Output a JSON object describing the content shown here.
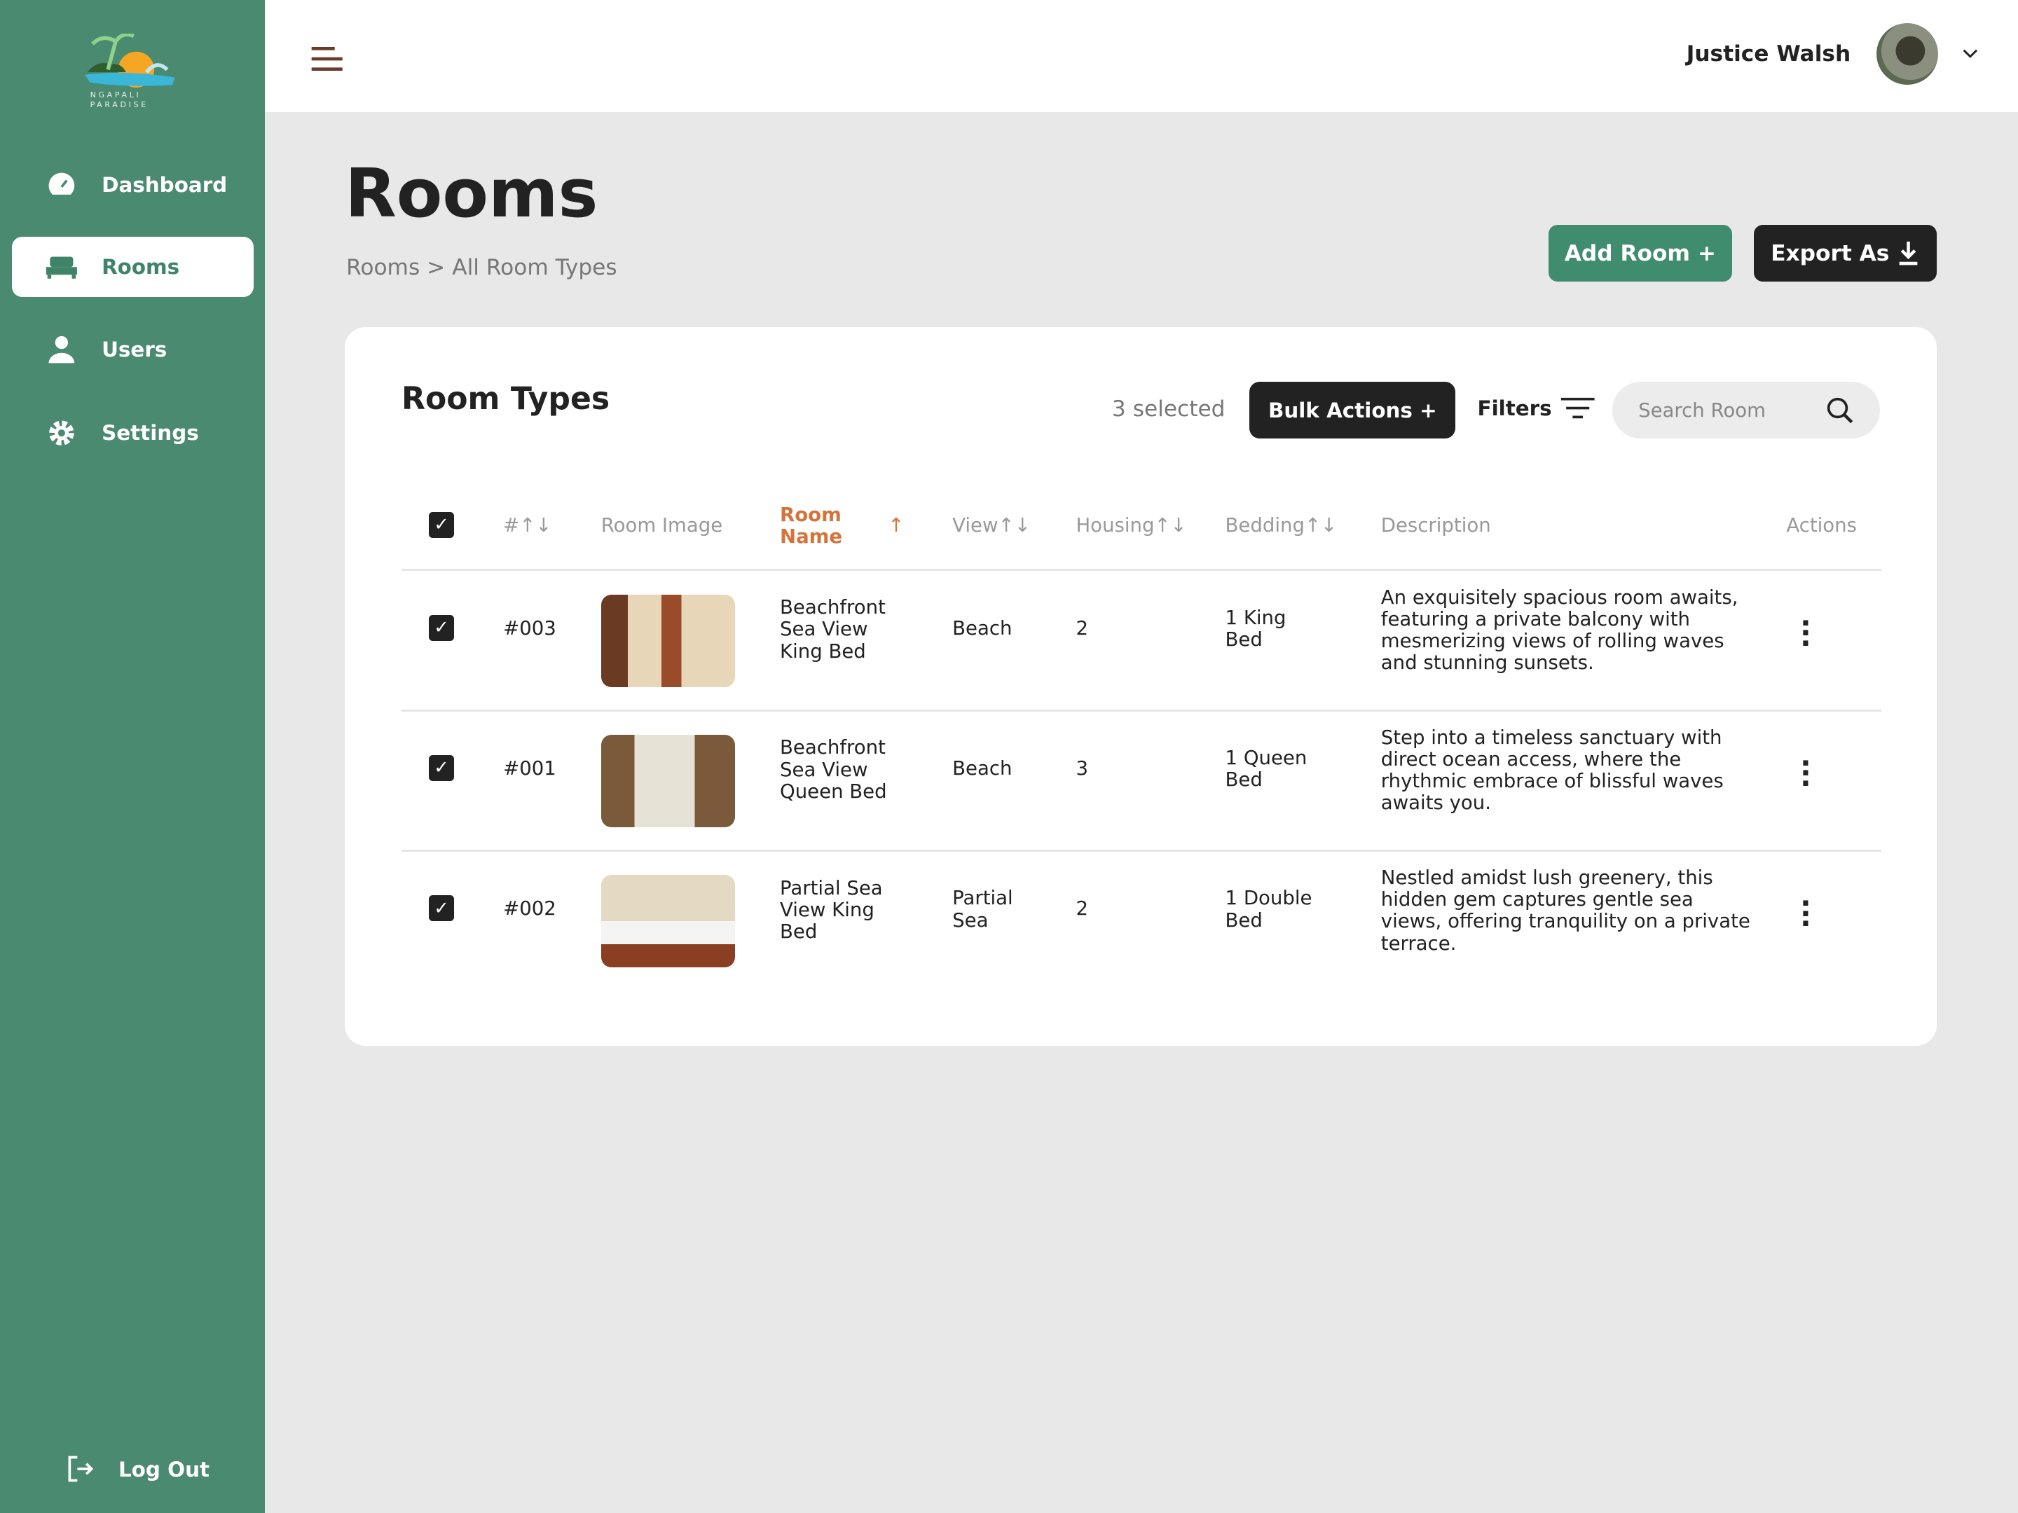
{
  "logo": {
    "line1": "NGAPALI",
    "line2": "PARADISE"
  },
  "sidebar": {
    "items": [
      {
        "label": "Dashboard"
      },
      {
        "label": "Rooms"
      },
      {
        "label": "Users"
      },
      {
        "label": "Settings"
      }
    ],
    "logout": "Log Out"
  },
  "header": {
    "user_name": "Justice Walsh"
  },
  "page": {
    "title": "Rooms",
    "breadcrumb": "Rooms > All Room Types",
    "add_label": "Add Room +",
    "export_label": "Export As"
  },
  "card": {
    "title": "Room Types",
    "selected": "3 selected",
    "bulk_label": "Bulk Actions +",
    "filters_label": "Filters",
    "search_placeholder": "Search Room"
  },
  "columns": {
    "num": "#↑↓",
    "image": "Room Image",
    "name": "Room Name",
    "sort": "↑",
    "view": "View↑↓",
    "housing": "Housing↑↓",
    "bedding": "Bedding↑↓",
    "description": "Description",
    "actions": "Actions"
  },
  "rows": [
    {
      "id": "#003",
      "name": "Beachfront Sea View King Bed",
      "view": "Beach",
      "housing": "2",
      "bedding": "1 King Bed",
      "description": "An exquisitely spacious room awaits, featuring a private balcony with mesmerizing views of rolling waves and stunning sunsets."
    },
    {
      "id": "#001",
      "name": "Beachfront Sea View Queen Bed",
      "view": "Beach",
      "housing": "3",
      "bedding": "1 Queen Bed",
      "description": "Step into a timeless sanctuary with direct ocean access, where the rhythmic embrace of blissful waves awaits you."
    },
    {
      "id": "#002",
      "name": "Partial Sea View King Bed",
      "view": "Partial Sea",
      "housing": "2",
      "bedding": "1 Double Bed",
      "description": "Nestled amidst lush greenery, this hidden gem captures gentle sea views, offering tranquility on a private terrace."
    }
  ],
  "colors": {
    "sidebar": "#4a8a70",
    "accent": "#d4733a",
    "primary": "#3f8c6e",
    "dark": "#222222"
  }
}
